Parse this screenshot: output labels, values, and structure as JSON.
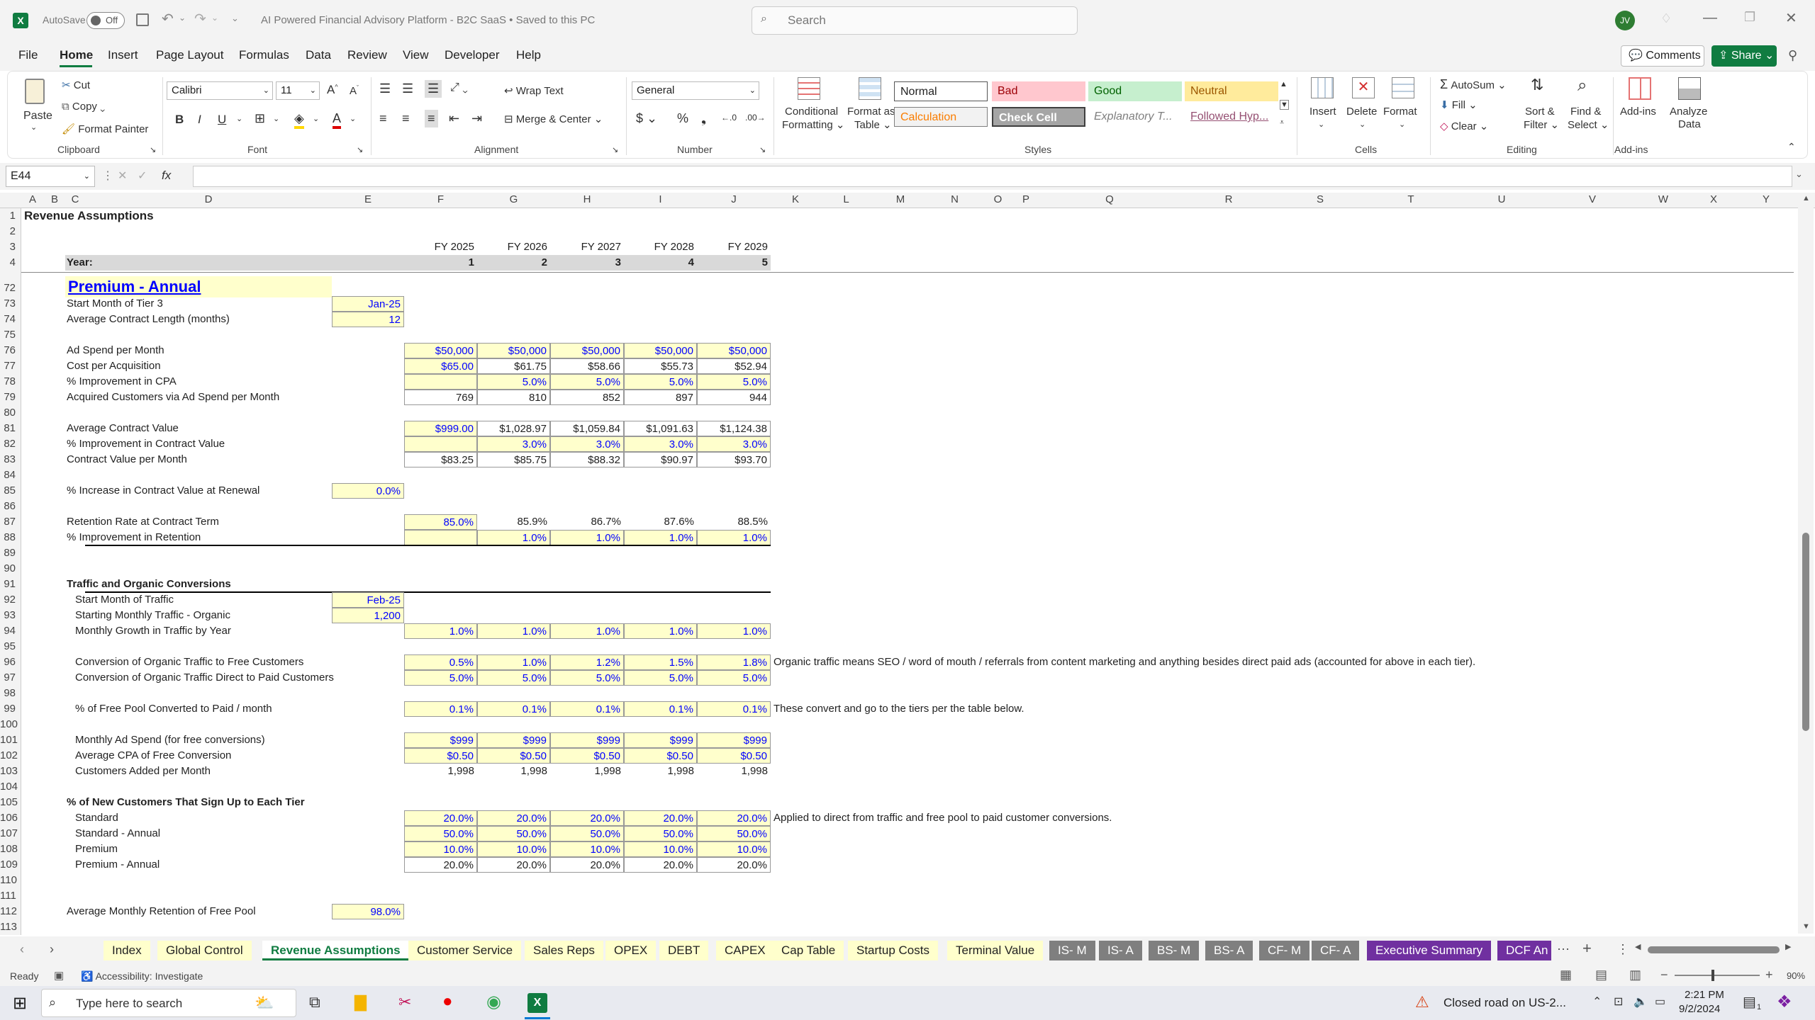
{
  "title": {
    "autosave_label": "AutoSave",
    "autosave_state": "Off",
    "doc_title": "AI Powered Financial Advisory Platform - B2C SaaS  •  Saved to this PC",
    "search_placeholder": "Search",
    "user_initials": "JV"
  },
  "menu": [
    "File",
    "Home",
    "Insert",
    "Page Layout",
    "Formulas",
    "Data",
    "Review",
    "View",
    "Developer",
    "Help"
  ],
  "menu_active": "Home",
  "comments_label": "Comments",
  "share_label": "Share",
  "ribbon": {
    "clipboard": {
      "paste": "Paste",
      "cut": "Cut",
      "copy": "Copy",
      "format_painter": "Format Painter",
      "group": "Clipboard"
    },
    "font": {
      "name": "Calibri",
      "size": "11",
      "group": "Font"
    },
    "alignment": {
      "wrap": "Wrap Text",
      "merge": "Merge & Center",
      "group": "Alignment"
    },
    "number": {
      "format": "General",
      "group": "Number"
    },
    "styles": {
      "cond": "Conditional",
      "cond2": "Formatting",
      "fmt_table": "Format as",
      "fmt_table2": "Table",
      "normal": "Normal",
      "bad": "Bad",
      "good": "Good",
      "neutral": "Neutral",
      "calculation": "Calculation",
      "check": "Check Cell",
      "explanatory": "Explanatory T...",
      "followed": "Followed Hyp...",
      "group": "Styles"
    },
    "cells": {
      "insert": "Insert",
      "delete": "Delete",
      "format": "Format",
      "group": "Cells"
    },
    "editing": {
      "autosum": "AutoSum",
      "fill": "Fill",
      "clear": "Clear",
      "sort": "Sort &",
      "sort2": "Filter",
      "find": "Find &",
      "find2": "Select",
      "group": "Editing"
    },
    "addins": {
      "addins": "Add-ins",
      "analyze": "Analyze",
      "analyze2": "Data",
      "group": "Add-ins"
    }
  },
  "namebox": "E44",
  "fx": "fx",
  "columns": [
    "A",
    "B",
    "C",
    "D",
    "E",
    "F",
    "G",
    "H",
    "I",
    "J",
    "K",
    "L",
    "M",
    "N",
    "O",
    "P",
    "Q",
    "R",
    "S",
    "T",
    "U",
    "V",
    "W",
    "X",
    "Y"
  ],
  "rows": {
    "r1": "Revenue Assumptions",
    "years": [
      "FY 2025",
      "FY 2026",
      "FY 2027",
      "FY 2028",
      "FY 2029"
    ],
    "year_label": "Year:",
    "year_nums": [
      "1",
      "2",
      "3",
      "4",
      "5"
    ],
    "section": "Premium - Annual",
    "start_month_label": "Start Month of Tier 3",
    "start_month": "Jan-25",
    "contract_len_label": "Average Contract Length (months)",
    "contract_len": "12",
    "ad_spend_label": "Ad Spend per Month",
    "ad_spend": [
      "$50,000",
      "$50,000",
      "$50,000",
      "$50,000",
      "$50,000"
    ],
    "cpa_label": "Cost per Acquisition",
    "cpa": [
      "$65.00",
      "$61.75",
      "$58.66",
      "$55.73",
      "$52.94"
    ],
    "cpa_imp_label": "% Improvement in CPA",
    "cpa_imp": [
      "",
      "5.0%",
      "5.0%",
      "5.0%",
      "5.0%"
    ],
    "acq_label": "Acquired Customers via Ad Spend per Month",
    "acq": [
      "769",
      "810",
      "852",
      "897",
      "944"
    ],
    "acv_label": "Average Contract Value",
    "acv": [
      "$999.00",
      "$1,028.97",
      "$1,059.84",
      "$1,091.63",
      "$1,124.38"
    ],
    "acv_imp_label": "% Improvement in Contract Value",
    "acv_imp": [
      "",
      "3.0%",
      "3.0%",
      "3.0%",
      "3.0%"
    ],
    "cvpm_label": "Contract Value per Month",
    "cvpm": [
      "$83.25",
      "$85.75",
      "$88.32",
      "$90.97",
      "$93.70"
    ],
    "renewal_label": "% Increase in Contract Value at Renewal",
    "renewal": "0.0%",
    "ret_label": "Retention Rate at Contract Term",
    "ret": [
      "85.0%",
      "85.9%",
      "86.7%",
      "87.6%",
      "88.5%"
    ],
    "ret_imp_label": "% Improvement in Retention",
    "ret_imp": [
      "",
      "1.0%",
      "1.0%",
      "1.0%",
      "1.0%"
    ],
    "traffic_hdr": "Traffic and Organic Conversions",
    "traffic_start_label": "Start Month of Traffic",
    "traffic_start": "Feb-25",
    "traffic_org_label": "Starting Monthly Traffic - Organic",
    "traffic_org": "1,200",
    "traffic_growth_label": "Monthly Growth in Traffic by Year",
    "traffic_growth": [
      "1.0%",
      "1.0%",
      "1.0%",
      "1.0%",
      "1.0%"
    ],
    "conv_free_label": "Conversion of Organic Traffic to Free Customers",
    "conv_free": [
      "0.5%",
      "1.0%",
      "1.2%",
      "1.5%",
      "1.8%"
    ],
    "conv_paid_label": "Conversion of Organic Traffic Direct to Paid Customers",
    "conv_paid": [
      "5.0%",
      "5.0%",
      "5.0%",
      "5.0%",
      "5.0%"
    ],
    "note96": "Organic traffic means SEO / word of mouth / referrals from content marketing and anything besides direct paid ads (accounted for above in each tier).",
    "free_pool_label": "% of Free Pool Converted to Paid / month",
    "free_pool": [
      "0.1%",
      "0.1%",
      "0.1%",
      "0.1%",
      "0.1%"
    ],
    "note99": "These convert and go to the tiers per the table below.",
    "ad_free_label": "Monthly Ad Spend (for free conversions)",
    "ad_free": [
      "$999",
      "$999",
      "$999",
      "$999",
      "$999"
    ],
    "cpa_free_label": "Average CPA of Free Conversion",
    "cpa_free": [
      "$0.50",
      "$0.50",
      "$0.50",
      "$0.50",
      "$0.50"
    ],
    "added_label": "Customers Added per Month",
    "added": [
      "1,998",
      "1,998",
      "1,998",
      "1,998",
      "1,998"
    ],
    "tier_hdr": "% of New Customers That Sign Up to Each Tier",
    "std_label": "Standard",
    "std": [
      "20.0%",
      "20.0%",
      "20.0%",
      "20.0%",
      "20.0%"
    ],
    "note106": "Applied to direct from traffic and free pool to paid customer conversions.",
    "stda_label": "Standard - Annual",
    "stda": [
      "50.0%",
      "50.0%",
      "50.0%",
      "50.0%",
      "50.0%"
    ],
    "prem_label": "Premium",
    "prem": [
      "10.0%",
      "10.0%",
      "10.0%",
      "10.0%",
      "10.0%"
    ],
    "prema_label": "Premium - Annual",
    "prema": [
      "20.0%",
      "20.0%",
      "20.0%",
      "20.0%",
      "20.0%"
    ],
    "freeret_label": "Average Monthly Retention of Free Pool",
    "freeret": "98.0%"
  },
  "row_numbers": [
    "1",
    "2",
    "3",
    "4",
    "72",
    "73",
    "74",
    "75",
    "76",
    "77",
    "78",
    "79",
    "80",
    "81",
    "82",
    "83",
    "84",
    "85",
    "86",
    "87",
    "88",
    "89",
    "90",
    "91",
    "92",
    "93",
    "94",
    "95",
    "96",
    "97",
    "98",
    "99",
    "100",
    "101",
    "102",
    "103",
    "104",
    "105",
    "106",
    "107",
    "108",
    "109",
    "110",
    "111",
    "112",
    "113"
  ],
  "sheet_tabs": [
    "Index",
    "Global Control",
    "Revenue Assumptions",
    "Customer Service",
    "Sales Reps",
    "OPEX",
    "DEBT",
    "CAPEX",
    "Cap Table",
    "Startup Costs",
    "Terminal Value",
    "IS- M",
    "IS- A",
    "BS- M",
    "BS- A",
    "CF- M",
    "CF- A",
    "Executive Summary",
    "DCF An"
  ],
  "active_tab": "Revenue Assumptions",
  "status": {
    "ready": "Ready",
    "accessibility": "Accessibility: Investigate",
    "zoom": "90%"
  },
  "taskbar": {
    "search": "Type here to search",
    "news": "Closed road on US-2...",
    "time": "2:21 PM",
    "date": "9/2/2024",
    "notif": "1"
  },
  "colors": {
    "excel_green": "#107c41",
    "input_yellow": "#ffffcc",
    "input_blue": "#0000ff",
    "link": "#0000ff"
  }
}
